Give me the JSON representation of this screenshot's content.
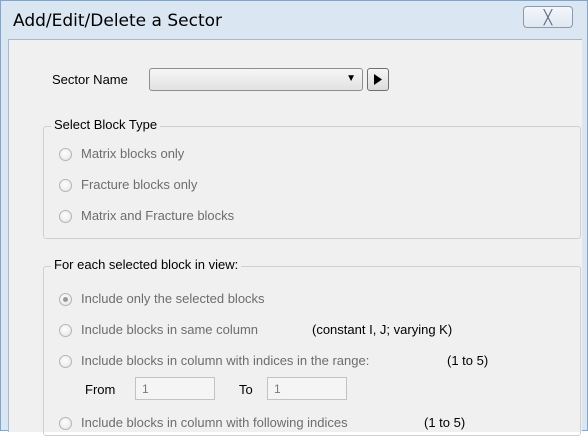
{
  "window": {
    "title": "Add/Edit/Delete a Sector",
    "close_glyph": "╳"
  },
  "sector": {
    "name_label": "Sector Name",
    "selected_value": "",
    "next_icon": "play-right-icon"
  },
  "block_type": {
    "group_label": "Select Block Type",
    "options": [
      {
        "label": "Matrix blocks only",
        "selected": false
      },
      {
        "label": "Fracture blocks only",
        "selected": false
      },
      {
        "label": "Matrix and Fracture blocks",
        "selected": false
      }
    ]
  },
  "selection": {
    "group_label": "For each selected block in view:",
    "options": [
      {
        "label": "Include only the selected blocks",
        "selected": true
      },
      {
        "label": "Include blocks in same column",
        "note": "(constant I, J; varying K)",
        "selected": false
      },
      {
        "label": "Include blocks in column with indices in the range:",
        "note": "(1 to 5)",
        "selected": false
      },
      {
        "label": "Include blocks in column with following indices",
        "note": "(1 to 5)",
        "selected": false
      }
    ],
    "from_label": "From",
    "from_value": "1",
    "to_label": "To",
    "to_value": "1"
  },
  "colors": {
    "frame": "#dbe6f3",
    "client": "#f0f0f0",
    "disabled_text": "#6d6d6d"
  }
}
